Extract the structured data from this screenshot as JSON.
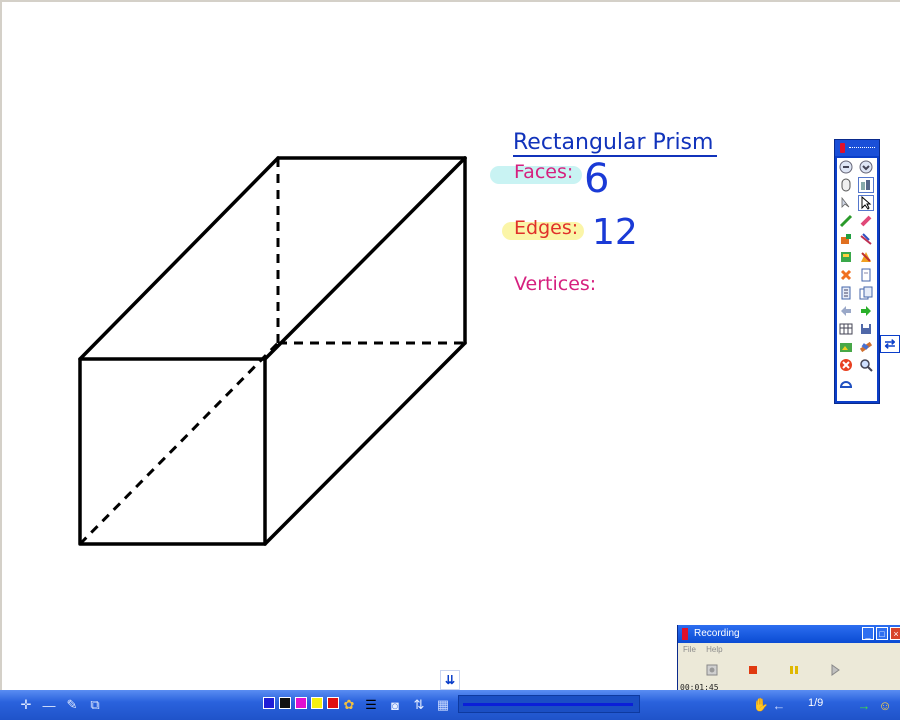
{
  "whiteboard": {
    "title": "Rectangular Prism",
    "faces_label": "Faces:",
    "faces_value": "6",
    "edges_label": "Edges:",
    "edges_value": "12",
    "vertices_label": "Vertices:"
  },
  "colors": {
    "title": "#1133bb",
    "label_pink": "#d6207f",
    "label_red": "#e0302a",
    "handwriting_blue": "#1a3ad6",
    "highlight_cyan": "#c9f3f3",
    "highlight_yellow": "#fbf5a8",
    "toolbar_blue": "#0a3ec9"
  },
  "tool_palette": {
    "icons": [
      "undo-icon",
      "redo-icon",
      "mouse-icon",
      "select-icon",
      "arrow-cursor-icon",
      "pointer-active-icon",
      "pen-icon",
      "eraser-icon",
      "fill-icon",
      "line-tool-icon",
      "insert-page-icon",
      "shape-tool-icon",
      "delete-icon",
      "new-page-icon",
      "page-list-icon",
      "duplicate-page-icon",
      "previous-page-icon",
      "next-page-icon",
      "table-icon",
      "save-icon",
      "capture-icon",
      "ruler-icon",
      "close-tool-icon",
      "zoom-icon",
      "protractor-icon"
    ]
  },
  "recording": {
    "title": "Recording",
    "menu": [
      "File",
      "Help"
    ],
    "elapsed": "00:01:45"
  },
  "taskbar": {
    "page_indicator": "1/9",
    "colors": [
      "#1f1fd6",
      "#111111",
      "#e010d0",
      "#f5f010",
      "#e01010"
    ],
    "progress": 0.99
  }
}
